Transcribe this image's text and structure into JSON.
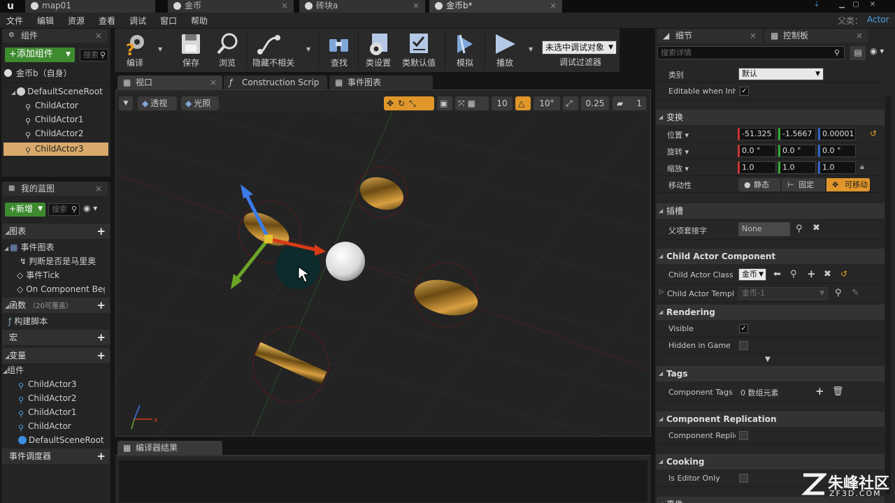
{
  "doc_tabs": [
    {
      "label": "map01"
    },
    {
      "label": "金币"
    },
    {
      "label": "砖块a"
    },
    {
      "label": "金币b*"
    }
  ],
  "parent": {
    "label": "父类：",
    "value": "Actor"
  },
  "menu": [
    "文件",
    "编辑",
    "资源",
    "查看",
    "调试",
    "窗口",
    "帮助"
  ],
  "components_panel": {
    "tab_label": "组件",
    "add_button": "+添加组件",
    "search_placeholder": "搜索",
    "self_item": "金币b（自身）",
    "tree": [
      "DefaultSceneRoot",
      "ChildActor",
      "ChildActor1",
      "ChildActor2",
      "ChildActor3"
    ]
  },
  "my_blueprint": {
    "tab_label": "我的蓝图",
    "new_button": "+新增",
    "search_placeholder": "搜索",
    "graphs_label": "图表",
    "event_graph_label": "事件图表",
    "event_items": [
      "判断是否是马里奥",
      "事件Tick",
      "On Component Beg"
    ],
    "functions_label": "函数",
    "functions_note": "（20可覆盖）",
    "construction_script": "构建脚本",
    "macros_label": "宏",
    "variables_label": "变量",
    "components_label": "组件",
    "var_components": [
      "ChildActor3",
      "ChildActor2",
      "ChildActor1",
      "ChildActor",
      "DefaultSceneRoot"
    ],
    "dispatchers_label": "事件调度器"
  },
  "toolbar": {
    "compile": "编译",
    "save": "保存",
    "browse": "浏览",
    "hide_unrelated": "隐藏不相关",
    "find": "查找",
    "class_settings": "类设置",
    "class_defaults": "类默认值",
    "simulate": "模拟",
    "play": "播放",
    "debug_dropdown": "未选中调试对象",
    "debug_filter": "调试过滤器"
  },
  "editor_tabs": [
    {
      "label": "视口"
    },
    {
      "label": "Construction Scrip"
    },
    {
      "label": "事件图表"
    }
  ],
  "viewport_toolbar": {
    "perspective": "透视",
    "lit": "光照",
    "grid_snap": "10",
    "rot_snap": "10°",
    "scale_snap": "0.25",
    "camera_speed": "1"
  },
  "compiler_results_tab": "编译器结果",
  "details": {
    "tab_label": "细节",
    "palette_tab": "控制板",
    "search_placeholder": "搜索详情",
    "category_label": "类别",
    "category_value": "默认",
    "editable_label": "Editable when Inher",
    "transform_head": "变换",
    "location_label": "位置",
    "location": [
      "-51.325",
      "-1.5667",
      "0.00001"
    ],
    "rotation_label": "旋转",
    "rotation": [
      "0.0 °",
      "0.0 °",
      "0.0 °"
    ],
    "scale_label": "缩放",
    "scale": [
      "1.0",
      "1.0",
      "1.0"
    ],
    "mobility_label": "移动性",
    "mobility": [
      "静态",
      "固定",
      "可移动"
    ],
    "sockets_head": "插槽",
    "parent_socket_label": "父项套接字",
    "parent_socket_value": "None",
    "child_actor_head": "Child Actor Component",
    "child_actor_class_label": "Child Actor Class",
    "child_actor_class_value": "金币",
    "child_actor_template_label": "Child Actor Templa",
    "child_actor_template_value": "金币-1",
    "rendering_head": "Rendering",
    "visible_label": "Visible",
    "hidden_label": "Hidden in Game",
    "tags_head": "Tags",
    "component_tags_label": "Component Tags",
    "component_tags_value": "0 数组元素",
    "replication_head": "Component Replication",
    "replication_label": "Component Replica",
    "cooking_head": "Cooking",
    "editor_only_label": "Is Editor Only",
    "events_head": "事件"
  },
  "watermark": {
    "main": "朱峰社区",
    "sub": "ZF3D.COM"
  }
}
